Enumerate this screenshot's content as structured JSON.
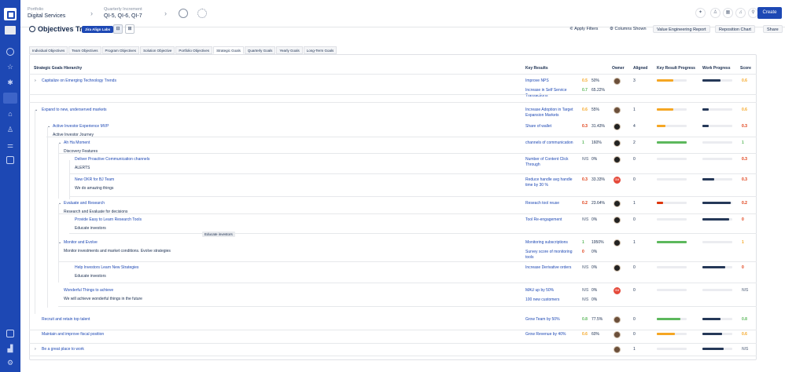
{
  "topbar": {
    "portfolio_label": "Portfolio",
    "portfolio_value": "Digital Services",
    "increment_label": "Quarterly Increment",
    "increment_value": "QI-5, QI-6, QI-7",
    "create": "Create"
  },
  "header": {
    "title": "Objectives Tree",
    "badge": "Jira Align Labs",
    "apply_filters": "Apply Filters",
    "columns_shown": "Columns Shown",
    "value_report": "Value Engineering Report",
    "reposition": "Reposition Chart",
    "share": "Share"
  },
  "tabs": [
    "Individual Objectives",
    "Team Objectives",
    "Program Objectives",
    "Solution Objective",
    "Portfolio Objectives",
    "Strategic Goals",
    "Quarterly Goals",
    "Yearly Goals",
    "Long-Term Goals"
  ],
  "columns": {
    "hierarchy": "Strategic Goals Hierarchy",
    "key_results": "Key Results",
    "owner": "Owner",
    "aligned": "Aligned",
    "kr_progress": "Key Result Progress",
    "work_progress": "Work Progress",
    "score": "Score"
  },
  "tooltip": "Educate investors",
  "colors": {
    "brand": "#1d48b4",
    "orange": "#f5a623",
    "green": "#5cb85c",
    "red": "#de350b",
    "navy": "#253858"
  },
  "rows": [
    {
      "caret": "›",
      "title": "Capitalize on Emerging Technology Trends",
      "desc": "",
      "kr": [
        {
          "t": "Improve NPS",
          "s": "0.5",
          "c": "#f5a623",
          "p": "50%"
        },
        {
          "t": "Increase in Self Service Transactions",
          "s": "0.7",
          "c": "#5cb85c",
          "p": "65.22%"
        }
      ],
      "owner": "m",
      "aligned": "3",
      "kp": 0.55,
      "kc": "#f5a623",
      "wp": 0.6,
      "score": "0.6",
      "sc": "#f5a623"
    },
    {
      "caret": "⌄",
      "title": "Expand to new, underserved markets",
      "desc": "",
      "kr": [
        {
          "t": "Increase Adoption in Target Expansion Markets",
          "s": "0.6",
          "c": "#f5a623",
          "p": "55%"
        }
      ],
      "owner": "m",
      "aligned": "1",
      "kp": 0.55,
      "kc": "#f5a623",
      "wp": 0.2,
      "score": "0.6",
      "sc": "#f5a623"
    },
    {
      "caret": "⌄",
      "title": "Active Investor Experience MVP",
      "desc": "Active Investor Journey",
      "kr": [
        {
          "t": "Share of wallet",
          "s": "0.3",
          "c": "#de350b",
          "p": "31.43%"
        }
      ],
      "owner": "j",
      "aligned": "4",
      "kp": 0.3,
      "kc": "#f5a623",
      "wp": 0.2,
      "score": "0.3",
      "sc": "#de350b"
    },
    {
      "caret": "⌄",
      "title": "Ah Ha Moment",
      "desc": "Discovery Features",
      "kr": [
        {
          "t": "channels of communication",
          "s": "1",
          "c": "#5cb85c",
          "p": "160%"
        }
      ],
      "owner": "j",
      "aligned": "2",
      "kp": 1,
      "kc": "#5cb85c",
      "wp": 0,
      "score": "1",
      "sc": "#5cb85c"
    },
    {
      "caret": "",
      "title": "Deliver Proactive Communication channels",
      "desc": "ALERTS",
      "kr": [
        {
          "t": "Number of Content Click Through",
          "s": "N/S",
          "c": "#8590a2",
          "p": "0%"
        }
      ],
      "owner": "j",
      "aligned": "0",
      "kp": 0,
      "kc": "#f5a623",
      "wp": 0,
      "score": "0.3",
      "sc": "#de350b"
    },
    {
      "caret": "",
      "title": "New OKR for BJ Team",
      "desc": "We do amazing things",
      "kr": [
        {
          "t": "Reduce handle avg handle time by 30 %",
          "s": "0.3",
          "c": "#de350b",
          "p": "33.33%"
        }
      ],
      "owner": "gm",
      "aligned": "0",
      "kp": 0,
      "kc": "#f5a623",
      "wp": 0.4,
      "score": "0.3",
      "sc": "#de350b"
    },
    {
      "caret": "⌄",
      "title": "Evaluate and Research",
      "desc": "Research and Evaluate for decisions",
      "kr": [
        {
          "t": "Reseach tool reuse",
          "s": "0.2",
          "c": "#de350b",
          "p": "23.64%"
        }
      ],
      "owner": "j",
      "aligned": "1",
      "kp": 0.2,
      "kc": "#de350b",
      "wp": 0.95,
      "score": "0.2",
      "sc": "#de350b"
    },
    {
      "caret": "",
      "title": "Provide Easy to Learn Research Tools",
      "desc": "Educate investors",
      "kr": [
        {
          "t": "Tool Re-engagement",
          "s": "N/S",
          "c": "#8590a2",
          "p": "0%"
        }
      ],
      "owner": "j",
      "aligned": "0",
      "kp": 0,
      "kc": "#f5a623",
      "wp": 0.9,
      "score": "0",
      "sc": "#de350b"
    },
    {
      "caret": "⌄",
      "title": "Monitor and Evolve",
      "desc": "Monitor investments and market conditions.   Evolve strategies",
      "kr": [
        {
          "t": "Monitoring subscriptions",
          "s": "1",
          "c": "#5cb85c",
          "p": "1950%"
        },
        {
          "t": "Survey score of monitoring tools",
          "s": "0",
          "c": "#de350b",
          "p": "0%"
        }
      ],
      "owner": "j",
      "aligned": "1",
      "kp": 1,
      "kc": "#5cb85c",
      "wp": 0,
      "score": "1",
      "sc": "#f5a623"
    },
    {
      "caret": "",
      "title": "Help Investors Learn New Strategies",
      "desc": "Educate investors",
      "kr": [
        {
          "t": "Increase Derivative orders",
          "s": "N/S",
          "c": "#8590a2",
          "p": "0%"
        }
      ],
      "owner": "j",
      "aligned": "0",
      "kp": 0,
      "kc": "#f5a623",
      "wp": 0.75,
      "score": "0",
      "sc": "#de350b"
    },
    {
      "caret": "",
      "title": "Wonderful Things to achieve",
      "desc": "We will achieve wonderful things in the future",
      "kr": [
        {
          "t": "MAU up by 50%",
          "s": "N/S",
          "c": "#8590a2",
          "p": "0%"
        },
        {
          "t": "100 new customers",
          "s": "N/S",
          "c": "#8590a2",
          "p": "0%"
        }
      ],
      "owner": "gm",
      "aligned": "0",
      "kp": 0,
      "kc": "#f5a623",
      "wp": 0,
      "score": "N/S",
      "sc": "#8590a2"
    },
    {
      "caret": "",
      "title": "Recruit and retain top talent",
      "desc": "",
      "kr": [
        {
          "t": "Grow Team by 50%",
          "s": "0.8",
          "c": "#5cb85c",
          "p": "77.5%"
        }
      ],
      "owner": "m",
      "aligned": "0",
      "kp": 0.8,
      "kc": "#5cb85c",
      "wp": 0.6,
      "score": "0.8",
      "sc": "#5cb85c"
    },
    {
      "caret": "",
      "title": "Maintain and improve fiscal position",
      "desc": "",
      "kr": [
        {
          "t": "Grow Revenue by 40%",
          "s": "0.6",
          "c": "#f5a623",
          "p": "60%"
        }
      ],
      "owner": "m",
      "aligned": "0",
      "kp": 0.6,
      "kc": "#f5a623",
      "wp": 0.65,
      "score": "0.6",
      "sc": "#f5a623"
    },
    {
      "caret": "›",
      "title": "Be a great place to work",
      "desc": "",
      "kr": [],
      "owner": "m",
      "aligned": "1",
      "kp": 0,
      "kc": "#f5a623",
      "wp": 0.7,
      "score": "N/S",
      "sc": "#8590a2"
    }
  ]
}
